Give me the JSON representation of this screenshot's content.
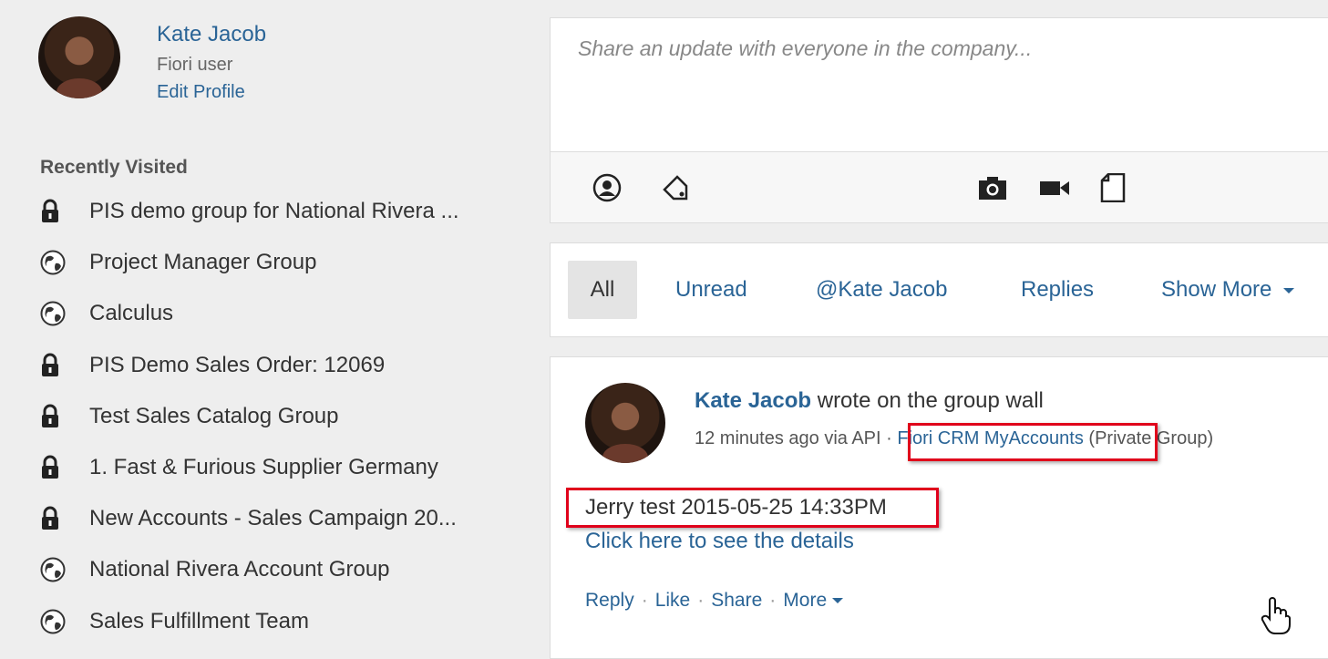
{
  "profile": {
    "name": "Kate Jacob",
    "role": "Fiori user",
    "edit_label": "Edit Profile"
  },
  "recently_visited": {
    "title": "Recently Visited",
    "items": [
      {
        "label": "PIS demo group for National Rivera ...",
        "icon": "lock-icon"
      },
      {
        "label": "Project Manager Group",
        "icon": "globe-icon"
      },
      {
        "label": "Calculus",
        "icon": "globe-icon"
      },
      {
        "label": "PIS Demo Sales Order: 12069",
        "icon": "lock-icon"
      },
      {
        "label": "Test Sales Catalog Group",
        "icon": "lock-icon"
      },
      {
        "label": "1. Fast & Furious Supplier Germany",
        "icon": "lock-icon"
      },
      {
        "label": "New Accounts - Sales Campaign 20...",
        "icon": "lock-icon"
      },
      {
        "label": "National Rivera Account Group",
        "icon": "globe-icon"
      },
      {
        "label": "Sales Fulfillment Team",
        "icon": "globe-icon"
      }
    ]
  },
  "compose": {
    "placeholder": "Share an update with everyone in the company..."
  },
  "toolbar": {
    "icons": [
      "mention-icon",
      "tag-icon",
      "camera-icon",
      "video-icon",
      "file-icon"
    ]
  },
  "filters": {
    "tabs": [
      "All",
      "Unread",
      "@Kate Jacob",
      "Replies",
      "Show More"
    ],
    "active": "All"
  },
  "post": {
    "author": "Kate Jacob",
    "action": "wrote on the group wall",
    "meta_prefix": "12 minutes ago via API ·",
    "group": "Fiori CRM MyAccounts",
    "group_suffix": "(Private Group)",
    "text": "Jerry test 2015-05-25 14:33PM",
    "link": "Click here to see the details",
    "actions": [
      "Reply",
      "Like",
      "Share",
      "More"
    ]
  },
  "colors": {
    "link": "#2a6496",
    "highlight": "#e0001b",
    "background": "#eeeeee"
  }
}
